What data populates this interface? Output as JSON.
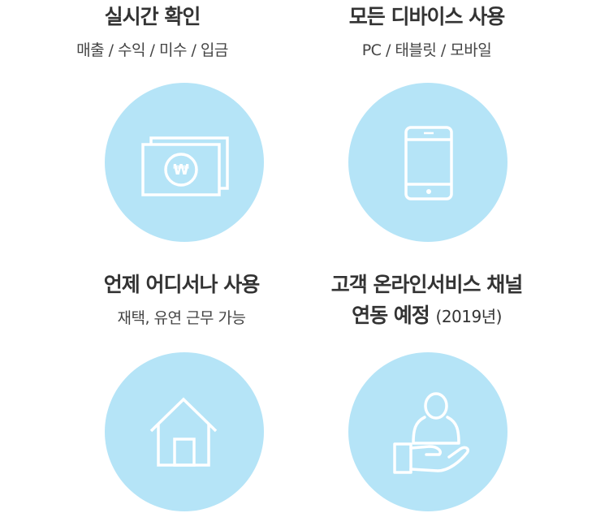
{
  "features": [
    {
      "title": "실시간 확인",
      "subtitle": "매출 / 수익 / 미수 / 입금",
      "icon": "money-icon"
    },
    {
      "title": "모든 디바이스 사용",
      "subtitle": "PC / 태블릿 / 모바일",
      "icon": "mobile-phone-icon"
    },
    {
      "title": "언제 어디서나 사용",
      "subtitle": "재택, 유연 근무 가능",
      "icon": "home-icon"
    },
    {
      "title_line1": "고객 온라인서비스 채널",
      "title_line2": "연동 예정",
      "title_note": "(2019년)",
      "icon": "customer-service-icon"
    }
  ],
  "colors": {
    "circle": "#b5e4f7",
    "icon_stroke": "#ffffff",
    "text": "#333333"
  }
}
